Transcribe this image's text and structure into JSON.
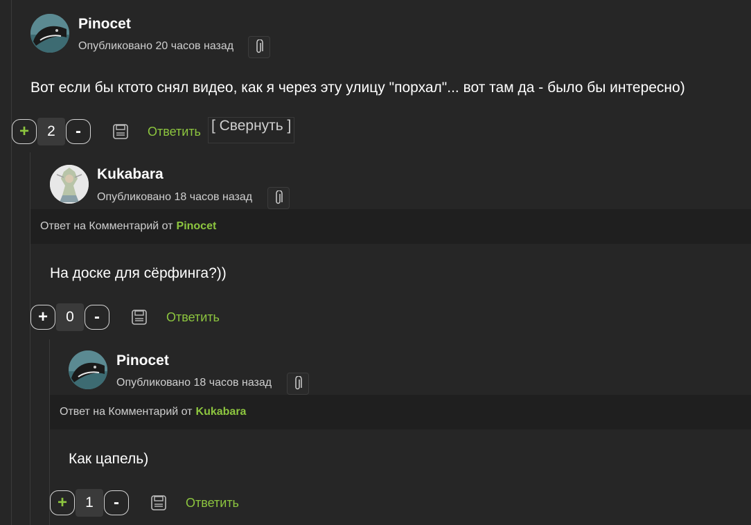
{
  "comments": [
    {
      "author": "Pinocet",
      "meta": "Опубликовано 20 часов назад",
      "body": "Вот если бы ктото снял видео, как я через эту улицу \"порхал\"... вот там да - было бы интересно)",
      "plus": "+",
      "votes": "2",
      "minus": "-",
      "reply_label": "Ответить",
      "collapse_label": "[ Свернуть ]"
    },
    {
      "author": "Kukabara",
      "meta": "Опубликовано 18 часов назад",
      "reply_prefix": "Ответ на Комментарий от",
      "reply_to": "Pinocet",
      "body": "На доске для сёрфинга?))",
      "plus": "+",
      "votes": "0",
      "minus": "-",
      "reply_label": "Ответить"
    },
    {
      "author": "Pinocet",
      "meta": "Опубликовано 18 часов назад",
      "reply_prefix": "Ответ на Комментарий от",
      "reply_to": "Kukabara",
      "body": "Как цапель)",
      "plus": "+",
      "votes": "1",
      "minus": "-",
      "reply_label": "Ответить"
    }
  ],
  "colors": {
    "background": "#262626",
    "accent": "#8dc63f",
    "reply_bar": "#1f1f1f"
  },
  "icons": {
    "clip": "paperclip-icon",
    "save": "floppy-disk-icon"
  }
}
